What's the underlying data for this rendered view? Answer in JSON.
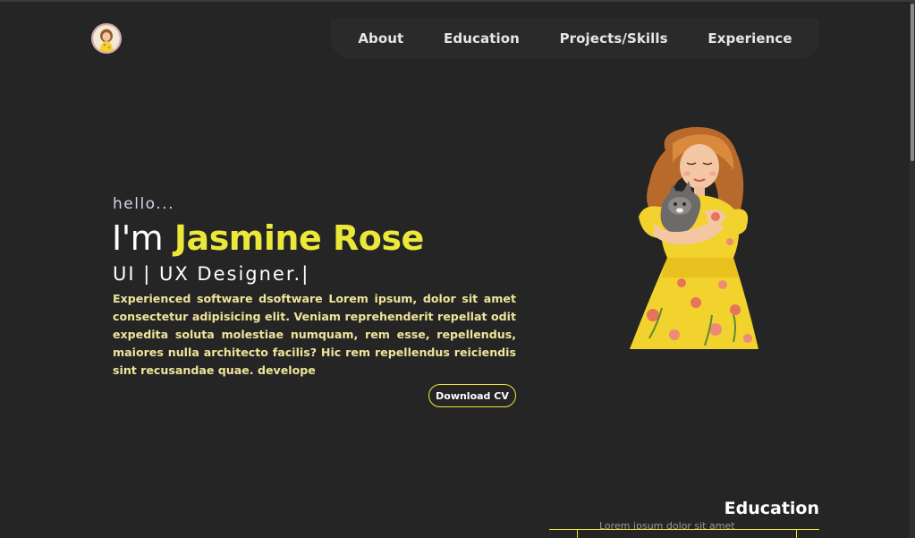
{
  "header": {
    "logo_icon": "avatar-logo-icon",
    "nav": [
      {
        "label": "About"
      },
      {
        "label": "Education"
      },
      {
        "label": "Projects/Skills"
      },
      {
        "label": "Experience"
      }
    ]
  },
  "hero": {
    "greeting": "hello...",
    "intro": "I'm",
    "name": "Jasmine Rose",
    "role": "UI | UX Designer.|",
    "description": "Experienced software dsoftware Lorem ipsum, dolor sit amet consectetur adipisicing elit. Veniam reprehenderit repellat odit expedita soluta molestiae numquam, rem esse, repellendus, maiores nulla architecto facilis? Hic rem repellendus reiciendis sint recusandae quae. develope",
    "cv_button": "Download CV",
    "illustration_icon": "girl-with-cat-illustration-icon"
  },
  "education": {
    "title": "Education",
    "snippet": "Lorem ipsum dolor sit amet"
  },
  "colors": {
    "background": "#252525",
    "accent": "#ece83a",
    "description_text": "#efe49a",
    "text": "#ffffff"
  }
}
